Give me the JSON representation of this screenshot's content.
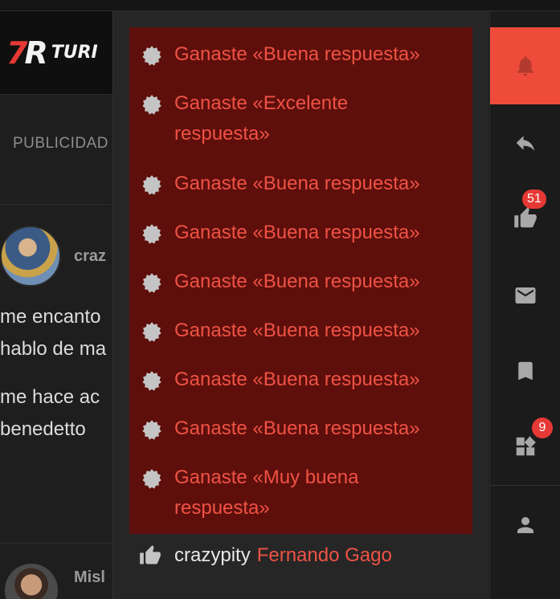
{
  "site": {
    "logo_text": "TURI",
    "advert_label": "PUBLICIDAD"
  },
  "post": {
    "author": "craz",
    "lines": [
      "me encanto",
      "hablo de ma",
      "me hace ac",
      "benedetto"
    ],
    "next_author": "Misl"
  },
  "alerts": [
    {
      "text": "Ganaste «Buena respuesta»"
    },
    {
      "text": "Ganaste «Excelente respuesta»"
    },
    {
      "text": "Ganaste «Buena respuesta»"
    },
    {
      "text": "Ganaste «Buena respuesta»"
    },
    {
      "text": "Ganaste «Buena respuesta»"
    },
    {
      "text": "Ganaste «Buena respuesta»"
    },
    {
      "text": "Ganaste «Buena respuesta»"
    },
    {
      "text": "Ganaste «Buena respuesta»"
    },
    {
      "text": "Ganaste «Muy buena respuesta»"
    }
  ],
  "reaction": {
    "user": "crazypity",
    "thread": "Fernando Gago"
  },
  "sidebar": {
    "reactions_count": "51",
    "awards_count": "9",
    "items": [
      "bell-icon",
      "reply-icon",
      "thumbs-up-icon",
      "envelope-icon",
      "bookmark-icon",
      "widgets-icon",
      "user-icon"
    ]
  },
  "colors": {
    "accent": "#ef4b3b",
    "alert_bg": "#5e0f0b",
    "alert_text": "#ef5245",
    "page_bg": "#1e1e1e"
  }
}
